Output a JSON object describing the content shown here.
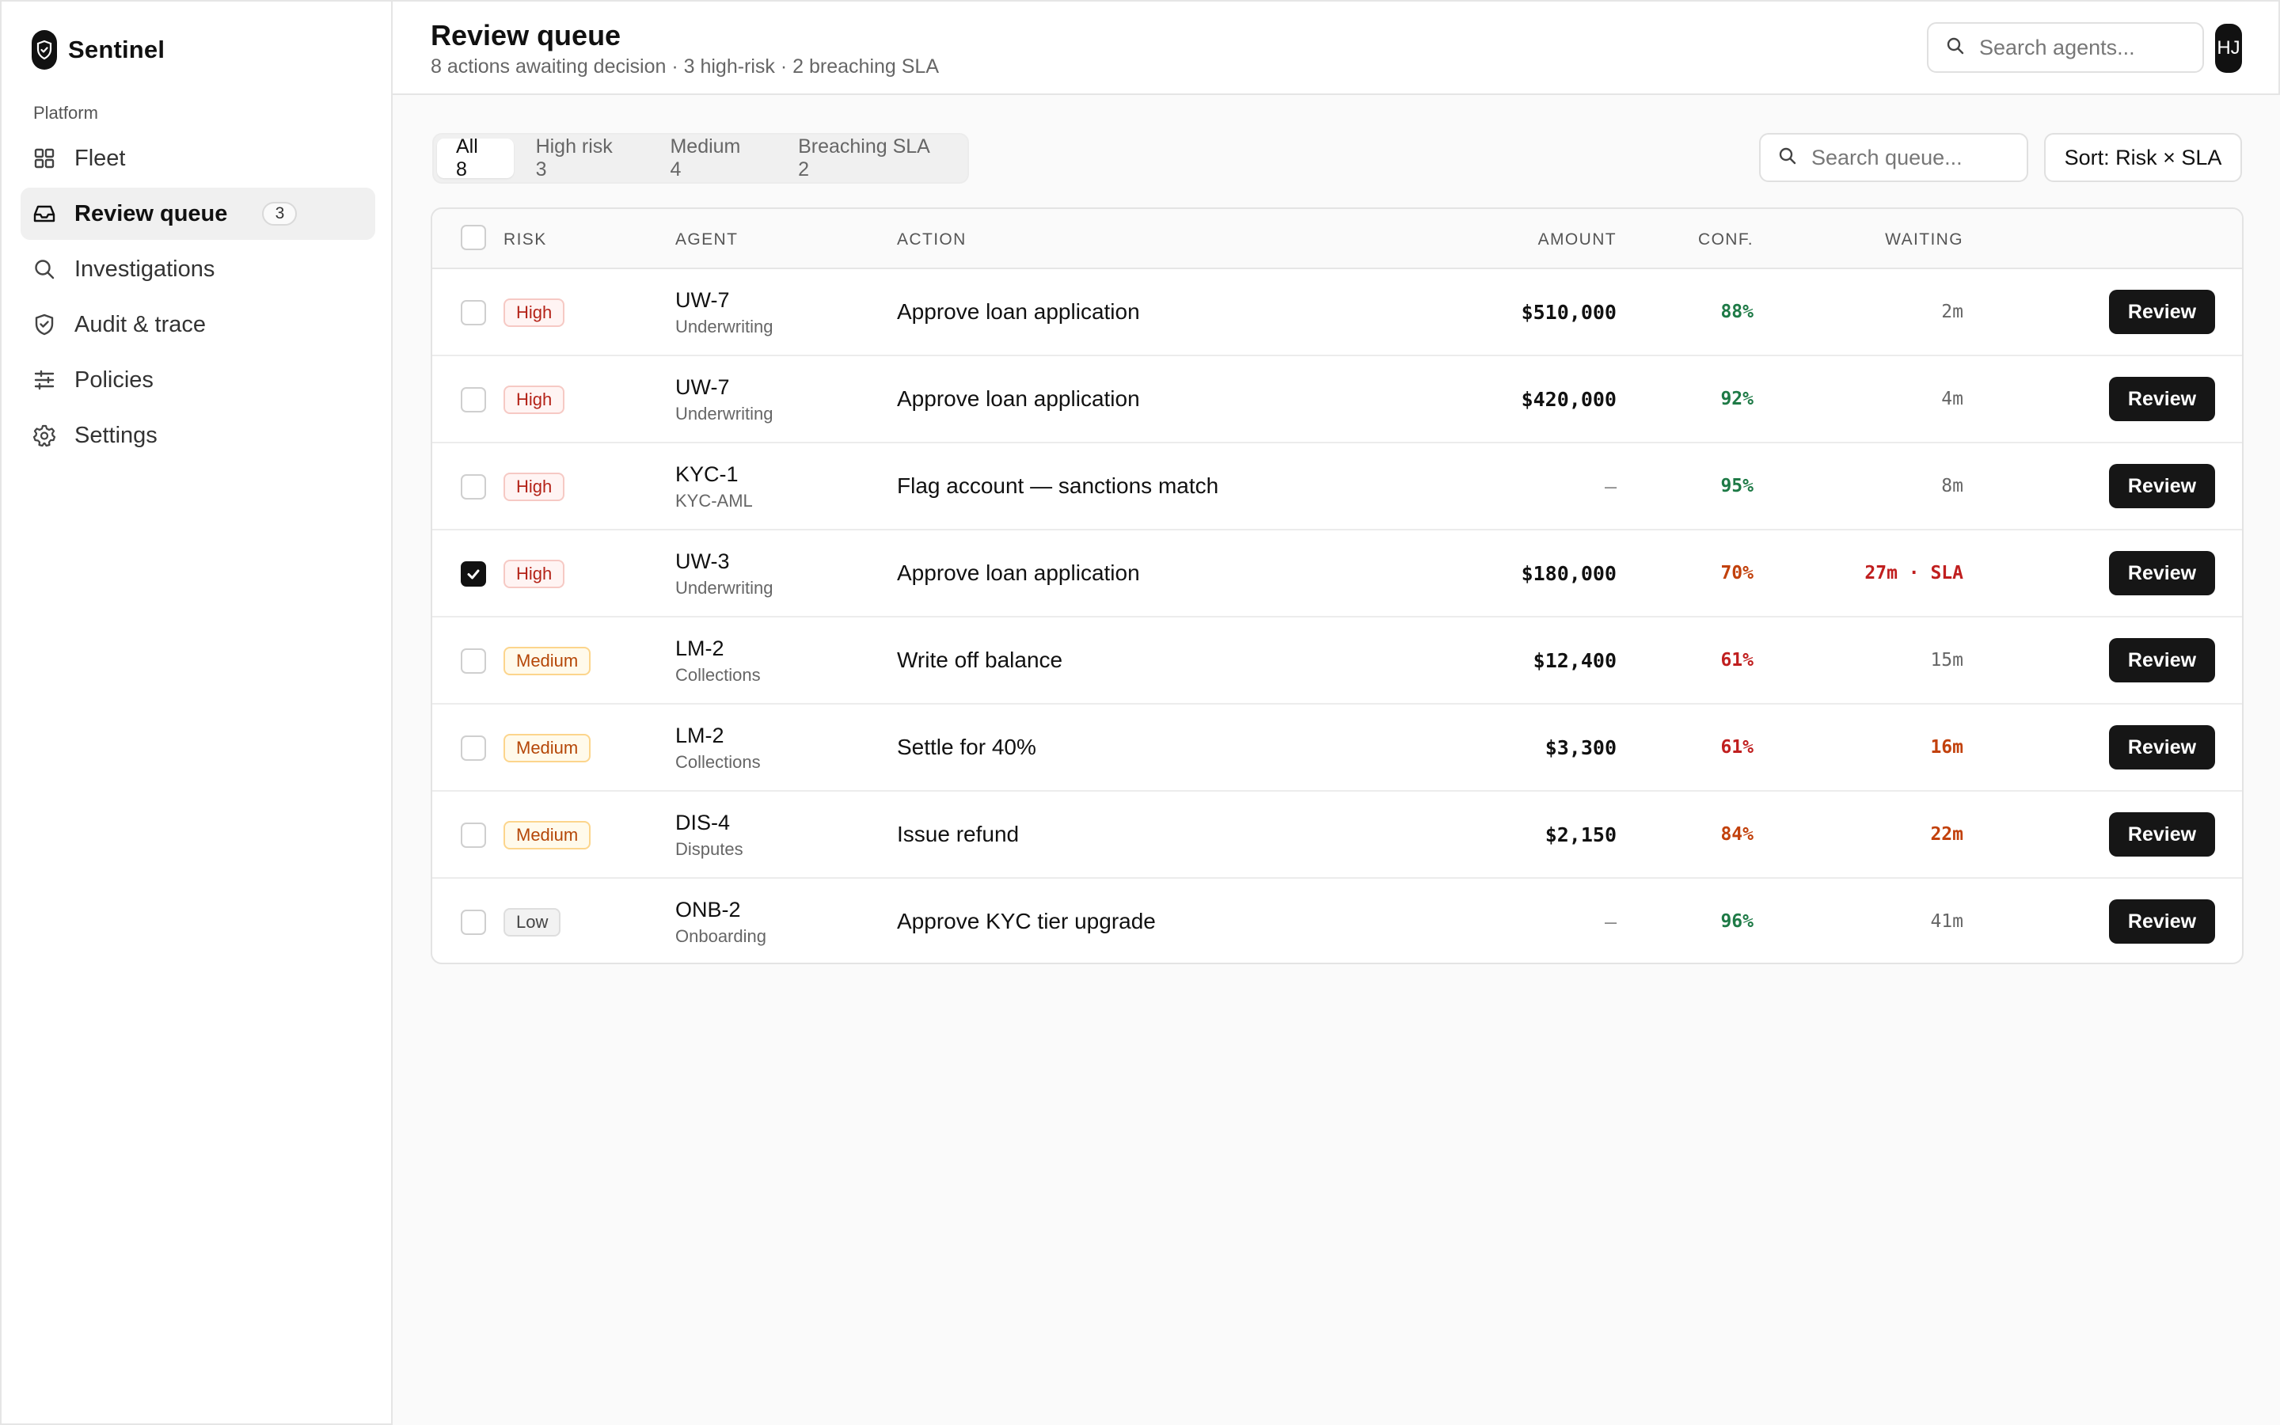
{
  "app": {
    "name": "Sentinel"
  },
  "sidebar": {
    "section": "Platform",
    "items": [
      {
        "label": "Fleet",
        "icon": "grid-icon"
      },
      {
        "label": "Review queue",
        "icon": "inbox-icon",
        "badge": "3",
        "active": true
      },
      {
        "label": "Investigations",
        "icon": "search-icon"
      },
      {
        "label": "Audit & trace",
        "icon": "shield-icon"
      },
      {
        "label": "Policies",
        "icon": "sliders-icon"
      },
      {
        "label": "Settings",
        "icon": "gear-icon"
      }
    ]
  },
  "header": {
    "title": "Review queue",
    "subtitle": "8 actions awaiting decision · 3 high-risk · 2 breaching SLA",
    "search_placeholder": "Search agents...",
    "avatar_initials": "HJ"
  },
  "toolbar": {
    "tabs": [
      {
        "label": "All 8",
        "active": true
      },
      {
        "label": "High risk 3"
      },
      {
        "label": "Medium 4"
      },
      {
        "label": "Breaching SLA 2"
      }
    ],
    "search_placeholder": "Search queue...",
    "sort_label": "Sort: Risk × SLA"
  },
  "table": {
    "columns": {
      "risk": "RISK",
      "agent": "AGENT",
      "action": "ACTION",
      "amount": "AMOUNT",
      "conf": "CONF.",
      "waiting": "WAITING"
    },
    "review_label": "Review",
    "rows": [
      {
        "risk": "High",
        "agent": "UW-7",
        "team": "Underwriting",
        "action": "Approve loan application",
        "amount": "$510,000",
        "conf": "88%",
        "waiting": "2m"
      },
      {
        "risk": "High",
        "agent": "UW-7",
        "team": "Underwriting",
        "action": "Approve loan application",
        "amount": "$420,000",
        "conf": "92%",
        "waiting": "4m"
      },
      {
        "risk": "High",
        "agent": "KYC-1",
        "team": "KYC-AML",
        "action": "Flag account — sanctions match",
        "amount": "–",
        "conf": "95%",
        "waiting": "8m"
      },
      {
        "risk": "High",
        "agent": "UW-3",
        "team": "Underwriting",
        "action": "Approve loan application",
        "amount": "$180,000",
        "conf": "70%",
        "waiting": "27m · SLA",
        "checked": true
      },
      {
        "risk": "Medium",
        "agent": "LM-2",
        "team": "Collections",
        "action": "Write off balance",
        "amount": "$12,400",
        "conf": "61%",
        "waiting": "15m"
      },
      {
        "risk": "Medium",
        "agent": "LM-2",
        "team": "Collections",
        "action": "Settle for 40%",
        "amount": "$3,300",
        "conf": "61%",
        "waiting": "16m"
      },
      {
        "risk": "Medium",
        "agent": "DIS-4",
        "team": "Disputes",
        "action": "Issue refund",
        "amount": "$2,150",
        "conf": "84%",
        "waiting": "22m"
      },
      {
        "risk": "Low",
        "agent": "ONB-2",
        "team": "Onboarding",
        "action": "Approve KYC tier upgrade",
        "amount": "–",
        "conf": "96%",
        "waiting": "41m"
      }
    ]
  },
  "colors": {
    "conf_good": "#1e7a46",
    "conf_warn": "#c2410c",
    "conf_bad": "#c01f1f",
    "wait_warn": "#c2410c",
    "wait_breach": "#c01f1f"
  }
}
